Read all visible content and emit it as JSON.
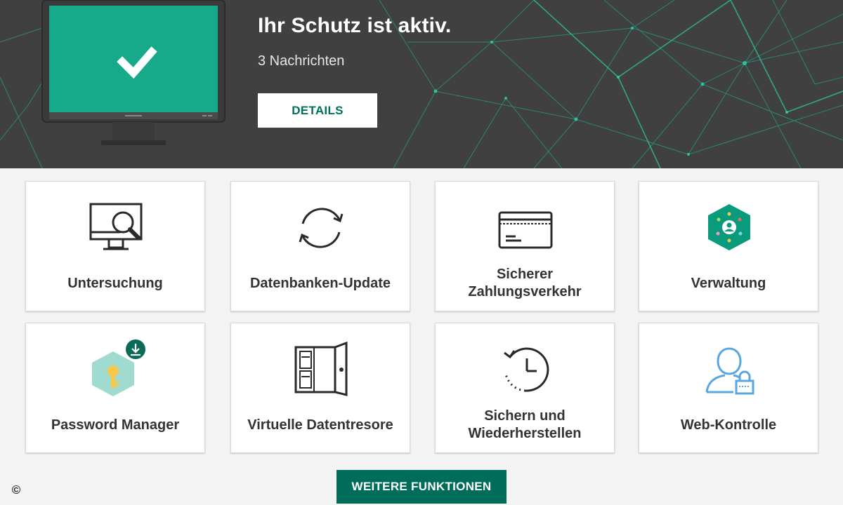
{
  "header": {
    "status_title": "Ihr Schutz ist aktiv.",
    "notifications": "3 Nachrichten",
    "details_label": "DETAILS",
    "accent_color": "#1abc9c",
    "screen_color": "#16a98a"
  },
  "tiles": [
    {
      "label": "Untersuchung",
      "icon": "monitor-magnifier-icon"
    },
    {
      "label": "Datenbanken-Update",
      "icon": "refresh-arrows-icon"
    },
    {
      "label": "Sicherer Zahlungsverkehr",
      "icon": "credit-card-icon"
    },
    {
      "label": "Verwaltung",
      "icon": "hexagon-user-network-icon"
    },
    {
      "label": "Password Manager",
      "icon": "hexagon-key-download-icon"
    },
    {
      "label": "Virtuelle Datentresore",
      "icon": "safe-vault-icon"
    },
    {
      "label": "Sichern und Wiederherstellen",
      "icon": "clock-restore-icon"
    },
    {
      "label": "Web-Kontrolle",
      "icon": "user-lock-icon"
    }
  ],
  "footer": {
    "more_label": "WEITERE FUNKTIONEN",
    "copyright_symbol": "©"
  },
  "colors": {
    "header_bg": "#404040",
    "brand_green": "#006d5b",
    "icon_blue": "#5aa7df",
    "page_bg": "#f3f3f3"
  }
}
